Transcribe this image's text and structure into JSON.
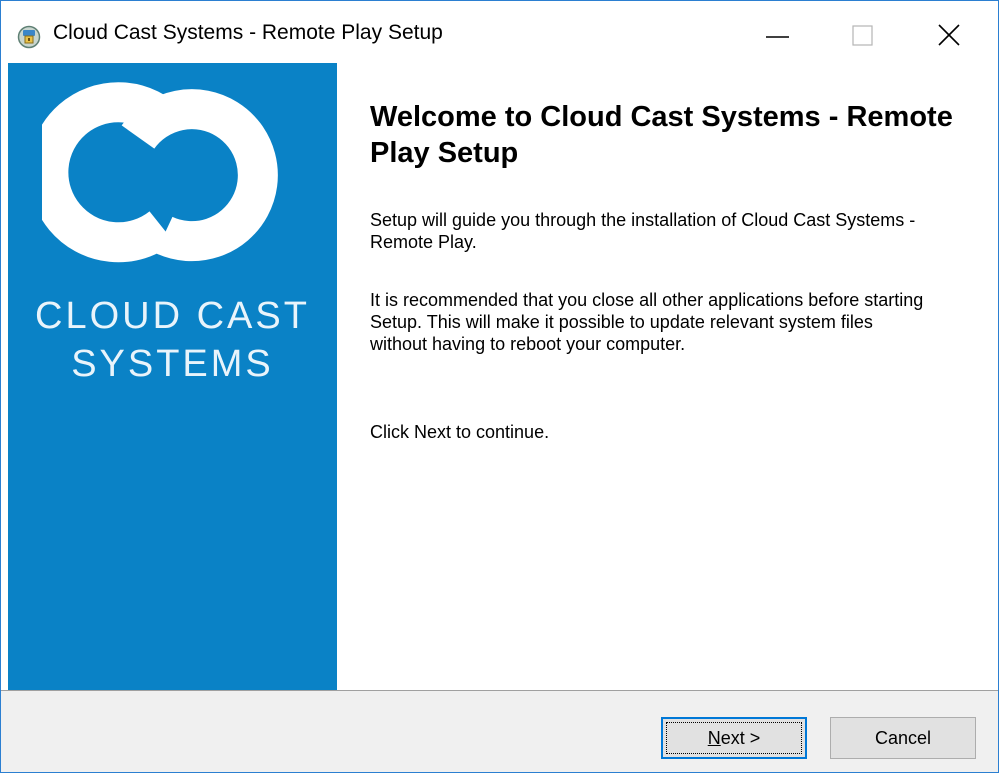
{
  "window": {
    "title": "Cloud Cast Systems - Remote Play Setup",
    "controls": [
      "minimize",
      "maximize",
      "close"
    ]
  },
  "banner": {
    "background_color": "#0a82c6",
    "logo_icon": "cloud-cast-logo-icon",
    "brand_line1": "CLOUD CAST",
    "brand_line2": "SYSTEMS"
  },
  "content": {
    "heading": "Welcome to Cloud Cast Systems - Remote Play Setup",
    "paragraph1": "Setup will guide you through the installation of Cloud Cast Systems - Remote Play.",
    "paragraph2": "It is recommended that you close all other applications before starting Setup. This will make it possible to update relevant system files without having to reboot your computer.",
    "paragraph3": "Click Next to continue."
  },
  "footer": {
    "next_label_accel": "N",
    "next_label_rest": "ext >",
    "cancel_label": "Cancel"
  },
  "colors": {
    "accent": "#0078d7",
    "banner": "#0a82c6",
    "footer_bg": "#f0f0f0"
  }
}
